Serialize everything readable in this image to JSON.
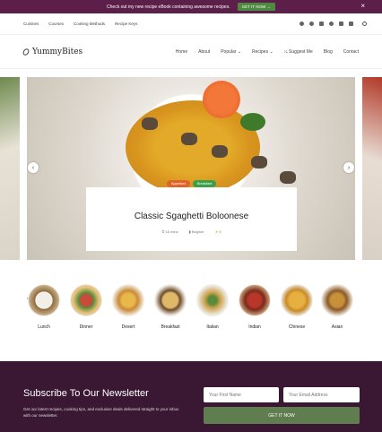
{
  "topbar": {
    "message": "Check out my new recipe eBook containing awesome recipes.",
    "cta": "GET IT NOW →",
    "close": "×"
  },
  "utility": {
    "links": [
      "Cuisines",
      "Courses",
      "Cooking Methods",
      "Recipe Keys"
    ]
  },
  "brand": {
    "name": "YummyBites"
  },
  "nav": {
    "items": [
      "Home",
      "About",
      "Popular ⌄",
      "Recipes ⌄",
      "⤯ Suggest Me",
      "Blog",
      "Contact"
    ]
  },
  "hero": {
    "tags": [
      {
        "label": "Appetizer",
        "color": "#e0642a"
      },
      {
        "label": "Breakfast",
        "color": "#3aa04a"
      }
    ],
    "title": "Classic Sgaghetti Boloonese",
    "meta": {
      "time": "15 mins",
      "level": "Beginer",
      "rating": "0"
    },
    "prev": "‹",
    "next": "›"
  },
  "categories": {
    "items": [
      {
        "label": "Lunch"
      },
      {
        "label": "Dinner"
      },
      {
        "label": "Desert"
      },
      {
        "label": "Breakfast"
      },
      {
        "label": "Italian"
      },
      {
        "label": "Indian"
      },
      {
        "label": "Chinese"
      },
      {
        "label": "Asian"
      }
    ],
    "prev": "‹",
    "next": "›"
  },
  "newsletter": {
    "heading": "Subscribe To Our Newsletter",
    "body": "Get our latest recipes, cooking tips, and exclusive deals delivered straight to your inbox with our newsletter.",
    "first_name_placeholder": "Your First Name",
    "email_placeholder": "Your Email Address",
    "submit": "GET IT NOW"
  }
}
